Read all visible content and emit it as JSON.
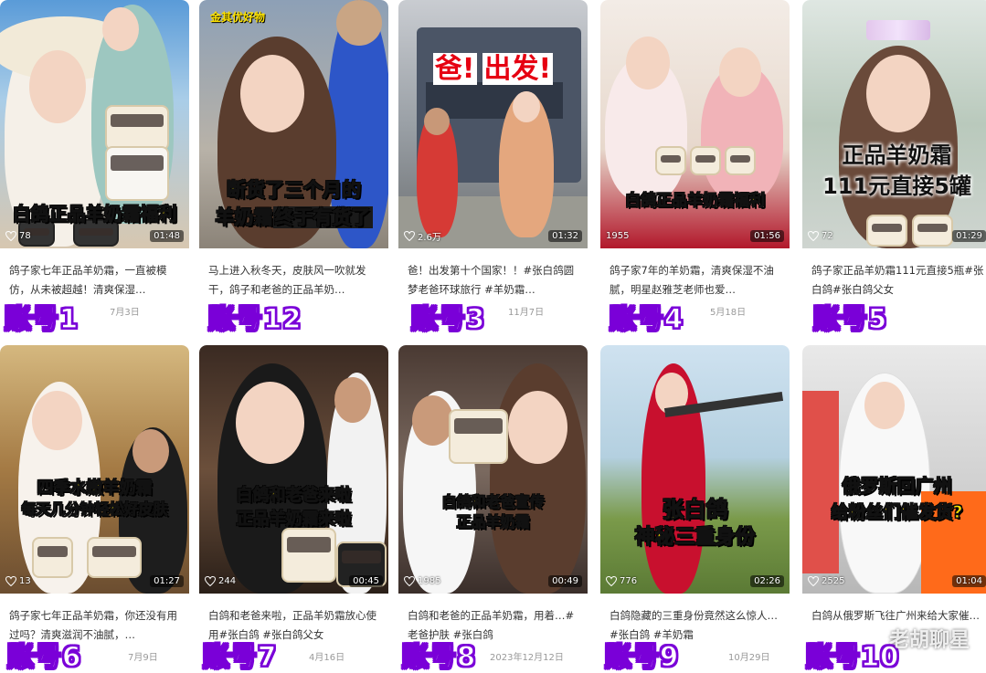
{
  "cards": [
    {
      "caption": "白鸽正品羊奶霜福利",
      "likes": "78",
      "duration": "01:48",
      "desc": "鸽子家七年正品羊奶霜，一直被模仿，从未被超越！清爽保湿…",
      "date": "7月3日",
      "account": "账号1"
    },
    {
      "top_tag": "金其优好物",
      "caption": "断货了三个月的",
      "caption2_a": "羊奶霜",
      "caption2_b": "终于有货了",
      "likes": "",
      "duration": "",
      "desc": "马上进入秋冬天，皮肤风一吹就发干，鸽子和老爸的正品羊奶…",
      "date": "",
      "account": "账号12"
    },
    {
      "caption_a": "爸!",
      "caption_b": "出发!",
      "likes": "2.6万",
      "duration": "01:32",
      "desc": "爸！出发第十个国家！！#张白鸽圆梦老爸环球旅行 #羊奶霜…",
      "date": "11月7日",
      "account": "账号3"
    },
    {
      "caption": "白鸽正品羊奶霜福利",
      "likes": "1955",
      "duration": "01:56",
      "desc": "鸽子家7年的羊奶霜，清爽保湿不油腻，明星赵雅芝老师也爱…",
      "date": "5月18日",
      "account": "账号4"
    },
    {
      "caption": "正品羊奶霜",
      "caption2": "111元直接5罐",
      "likes": "72",
      "duration": "01:29",
      "desc": "鸽子家正品羊奶霜111元直接5瓶#张白鸽#张白鸽父女",
      "date": "",
      "account": "账号5"
    },
    {
      "caption": "四季水嫩羊奶霜",
      "caption2": "每天几分钟轻松好皮肤",
      "likes": "13",
      "duration": "01:27",
      "desc": "鸽子家七年正品羊奶霜，你还没有用过吗？清爽滋润不油腻，…",
      "date": "7月9日",
      "account": "账号6"
    },
    {
      "caption": "白鸽和老爸来啦",
      "caption2": "正品羊奶霜来啦",
      "likes": "244",
      "duration": "00:45",
      "desc": "白鸽和老爸来啦，正品羊奶霜放心使用#张白鸽 #张白鸽父女",
      "date": "4月16日",
      "account": "账号7"
    },
    {
      "caption": "白鸽和老爸宣传",
      "caption2": "正品羊奶霜",
      "likes": "1985",
      "duration": "00:49",
      "desc": "白鸽和老爸的正品羊奶霜，用着…#老爸护肤 #张白鸽",
      "date": "2023年12月12日",
      "account": "账号8"
    },
    {
      "caption": "张白鸽",
      "caption2": "神秘三重身份",
      "likes": "776",
      "duration": "02:26",
      "desc": "白鸽隐藏的三重身份竟然这么惊人…#张白鸽 #羊奶霜",
      "date": "10月29日",
      "account": "账号9"
    },
    {
      "caption": "俄罗斯回广州",
      "caption2": "给粉丝们催发货?",
      "likes": "2525",
      "duration": "01:04",
      "desc": "白鸽从俄罗斯飞往广州来给大家催…",
      "date": "",
      "account": "账号10"
    }
  ],
  "watermark": "老胡聊星",
  "colors": {
    "account_stroke": "#7a00d8",
    "caption_yellow": "#ffe400"
  }
}
